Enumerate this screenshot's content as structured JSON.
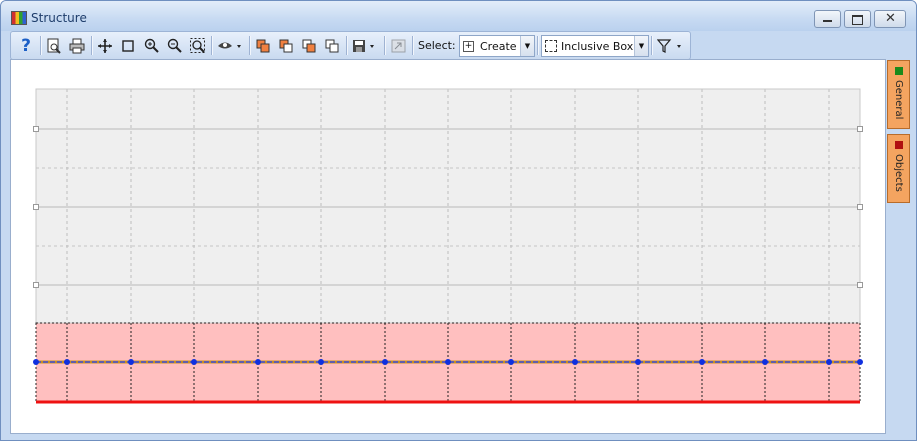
{
  "window": {
    "title": "Structure"
  },
  "toolbar": {
    "select_label": "Select:",
    "select_mode": "Create",
    "selection_type": "Inclusive Box",
    "icons": [
      "help-icon",
      "print-preview-icon",
      "print-icon",
      "pan-icon",
      "select-rect-icon",
      "zoom-in-icon",
      "zoom-out-icon",
      "zoom-fit-icon",
      "view-icon",
      "copy-layer1-icon",
      "copy-layer2-icon",
      "copy-layer3-icon",
      "copy-layer4-icon",
      "save-icon",
      "export-icon",
      "filter-icon"
    ]
  },
  "sidepanel": {
    "tabs": [
      {
        "label": "General",
        "color": "#1a8a1a"
      },
      {
        "label": "Objects",
        "color": "#b01010"
      }
    ]
  },
  "canvas": {
    "upper_zone_color": "#efefef",
    "lower_zone_color": "#ffbfbf",
    "axis_line_color": "#2040ff",
    "base_line_color": "#ee1111",
    "node_color": "#1030e0",
    "node_count": 15
  }
}
